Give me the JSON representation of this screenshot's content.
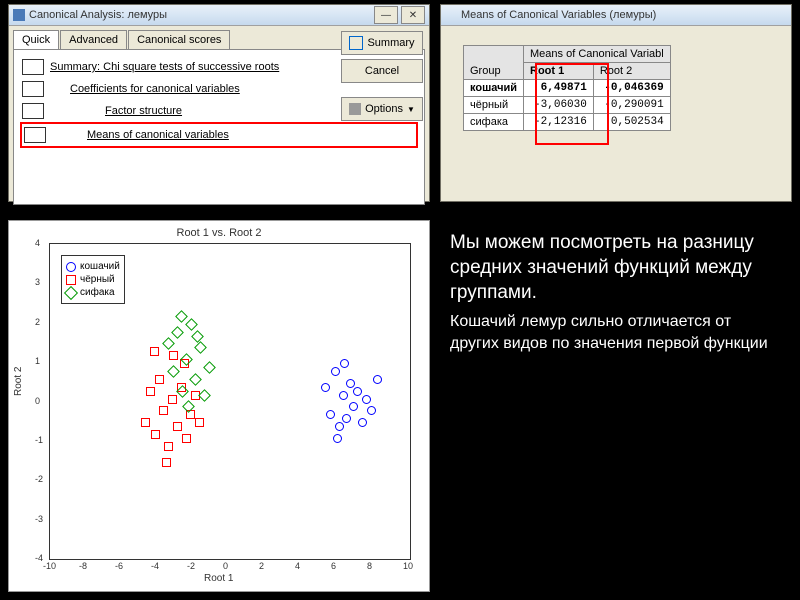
{
  "dialog": {
    "title": "Canonical Analysis: лемуры",
    "tabs": [
      "Quick",
      "Advanced",
      "Canonical scores"
    ],
    "items": [
      "Summary:  Chi square tests of successive roots",
      "Coefficients for canonical variables",
      "Factor structure",
      "Means of canonical variables"
    ],
    "summary_btn": "Summary",
    "cancel_btn": "Cancel",
    "options_btn": "Options"
  },
  "means": {
    "title": "Means of Canonical Variables (лемуры)",
    "header": "Means of Canonical Variabl",
    "group_label": "Group",
    "cols": [
      "Root 1",
      "Root 2"
    ],
    "rows": [
      {
        "g": "кошачий",
        "r1": "6,49871",
        "r2": "-0,046369",
        "bold": true
      },
      {
        "g": "чёрный",
        "r1": "-3,06030",
        "r2": "-0,290091",
        "bold": false
      },
      {
        "g": "сифака",
        "r1": "-2,12316",
        "r2": "0,502534",
        "bold": false
      }
    ]
  },
  "chart_data": {
    "type": "scatter",
    "title": "Root 1 vs. Root 2",
    "xlabel": "Root 1",
    "ylabel": "Root 2",
    "xlim": [
      -10,
      10
    ],
    "ylim": [
      -4,
      4
    ],
    "xticks": [
      -10,
      -8,
      -6,
      -4,
      -2,
      0,
      2,
      4,
      6,
      8,
      10
    ],
    "yticks": [
      -4,
      -3,
      -2,
      -1,
      0,
      1,
      2,
      3,
      4
    ],
    "series": [
      {
        "name": "кошачий",
        "marker": "circle",
        "color": "#0000ff",
        "points": [
          [
            5.2,
            0.4
          ],
          [
            5.5,
            -0.3
          ],
          [
            5.8,
            0.8
          ],
          [
            6.0,
            -0.6
          ],
          [
            6.2,
            0.2
          ],
          [
            6.4,
            -0.4
          ],
          [
            6.6,
            0.5
          ],
          [
            6.8,
            -0.1
          ],
          [
            7.0,
            0.3
          ],
          [
            7.3,
            -0.5
          ],
          [
            7.5,
            0.1
          ],
          [
            7.8,
            -0.2
          ],
          [
            8.1,
            0.6
          ],
          [
            6.3,
            1.0
          ],
          [
            5.9,
            -0.9
          ]
        ]
      },
      {
        "name": "чёрный",
        "marker": "square",
        "color": "#ff0000",
        "points": [
          [
            -4.8,
            -0.5
          ],
          [
            -4.5,
            0.3
          ],
          [
            -4.2,
            -0.8
          ],
          [
            -4.0,
            0.6
          ],
          [
            -3.8,
            -0.2
          ],
          [
            -3.5,
            -1.1
          ],
          [
            -3.3,
            0.1
          ],
          [
            -3.0,
            -0.6
          ],
          [
            -2.8,
            0.4
          ],
          [
            -2.5,
            -0.9
          ],
          [
            -2.3,
            -0.3
          ],
          [
            -2.0,
            0.2
          ],
          [
            -1.8,
            -0.5
          ],
          [
            -3.2,
            1.2
          ],
          [
            -3.6,
            -1.5
          ],
          [
            -2.6,
            1.0
          ],
          [
            -4.3,
            1.3
          ]
        ]
      },
      {
        "name": "сифака",
        "marker": "diamond",
        "color": "#009900",
        "points": [
          [
            -3.5,
            1.5
          ],
          [
            -3.2,
            0.8
          ],
          [
            -3.0,
            1.8
          ],
          [
            -2.7,
            0.3
          ],
          [
            -2.5,
            1.1
          ],
          [
            -2.2,
            2.0
          ],
          [
            -2.0,
            0.6
          ],
          [
            -1.7,
            1.4
          ],
          [
            -1.5,
            0.2
          ],
          [
            -1.2,
            0.9
          ],
          [
            -2.8,
            2.2
          ],
          [
            -2.4,
            -0.1
          ],
          [
            -1.9,
            1.7
          ]
        ]
      }
    ]
  },
  "legend": [
    "кошачий",
    "чёрный",
    "сифака"
  ],
  "note": {
    "p1": "Мы можем  посмотреть на разницу средних значений функций между группами.",
    "p2": "Кошачий лемур сильно отличается от других видов по значения первой функции"
  }
}
